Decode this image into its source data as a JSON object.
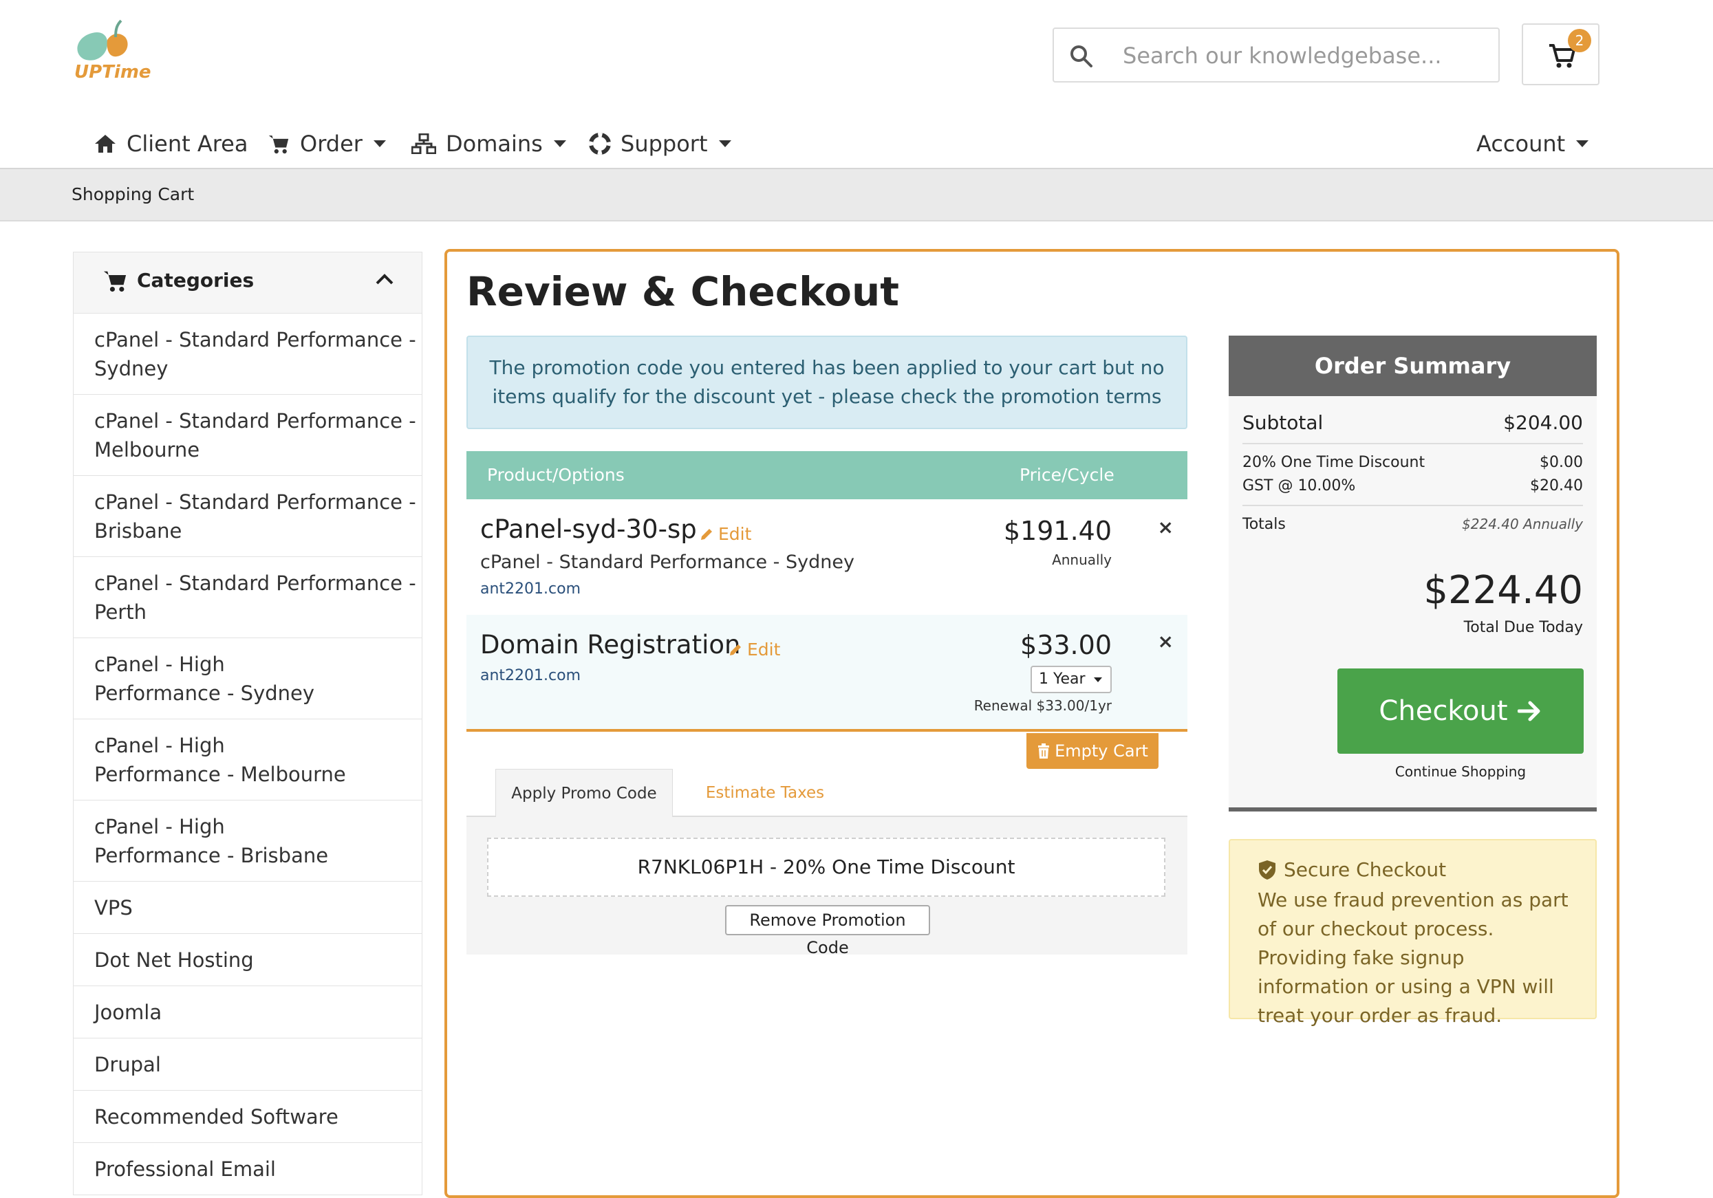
{
  "brand": {
    "name": "UPTime",
    "colors": {
      "accent": "#e49a3a",
      "teal": "#87c9b5",
      "green": "#4aa34a"
    }
  },
  "header": {
    "search_placeholder": "Search our knowledgebase...",
    "cart_count": "2"
  },
  "nav": {
    "client_area": "Client Area",
    "order": "Order",
    "domains": "Domains",
    "support": "Support",
    "account": "Account"
  },
  "breadcrumb": "Shopping Cart",
  "sidebar": {
    "title": "Categories",
    "items": [
      "cPanel - Standard Performance - Sydney",
      "cPanel - Standard Performance - Melbourne",
      "cPanel - Standard Performance - Brisbane",
      "cPanel - Standard Performance - Perth",
      "cPanel - High Performance - Sydney",
      "cPanel - High Performance - Melbourne",
      "cPanel - High Performance - Brisbane",
      "VPS",
      "Dot Net Hosting",
      "Joomla",
      "Drupal",
      "Recommended Software",
      "Professional Email"
    ]
  },
  "main": {
    "title": "Review & Checkout",
    "alert": "The promotion code you entered has been applied to your cart but no items qualify for the discount yet - please check the promotion terms",
    "table": {
      "col_product": "Product/Options",
      "col_price": "Price/Cycle",
      "edit_label": "Edit",
      "remove_symbol": "×",
      "items": [
        {
          "name": "cPanel-syd-30-sp",
          "description": "cPanel - Standard Performance - Sydney",
          "domain": "ant2201.com",
          "price": "$191.40",
          "cycle": "Annually"
        },
        {
          "name": "Domain Registration",
          "domain": "ant2201.com",
          "price": "$33.00",
          "period": "1 Year",
          "renewal": "Renewal $33.00/1yr"
        }
      ]
    },
    "empty_cart": "Empty Cart",
    "tabs": {
      "promo": "Apply Promo Code",
      "taxes": "Estimate Taxes"
    },
    "promo_code": "R7NKL06P1H - 20% One Time Discount",
    "remove_promo": "Remove Promotion Code"
  },
  "summary": {
    "title": "Order Summary",
    "subtotal_label": "Subtotal",
    "subtotal": "$204.00",
    "discount_label": "20% One Time Discount",
    "discount": "$0.00",
    "gst_label": "GST @ 10.00%",
    "gst": "$20.40",
    "totals_label": "Totals",
    "totals_cycle": "$224.40 Annually",
    "total": "$224.40",
    "total_due_label": "Total Due Today",
    "checkout": "Checkout",
    "continue": "Continue Shopping"
  },
  "secure": {
    "title": "Secure Checkout",
    "body": "We use fraud prevention as part of our checkout process. Providing fake signup information or using a VPN will treat your order as fraud."
  }
}
